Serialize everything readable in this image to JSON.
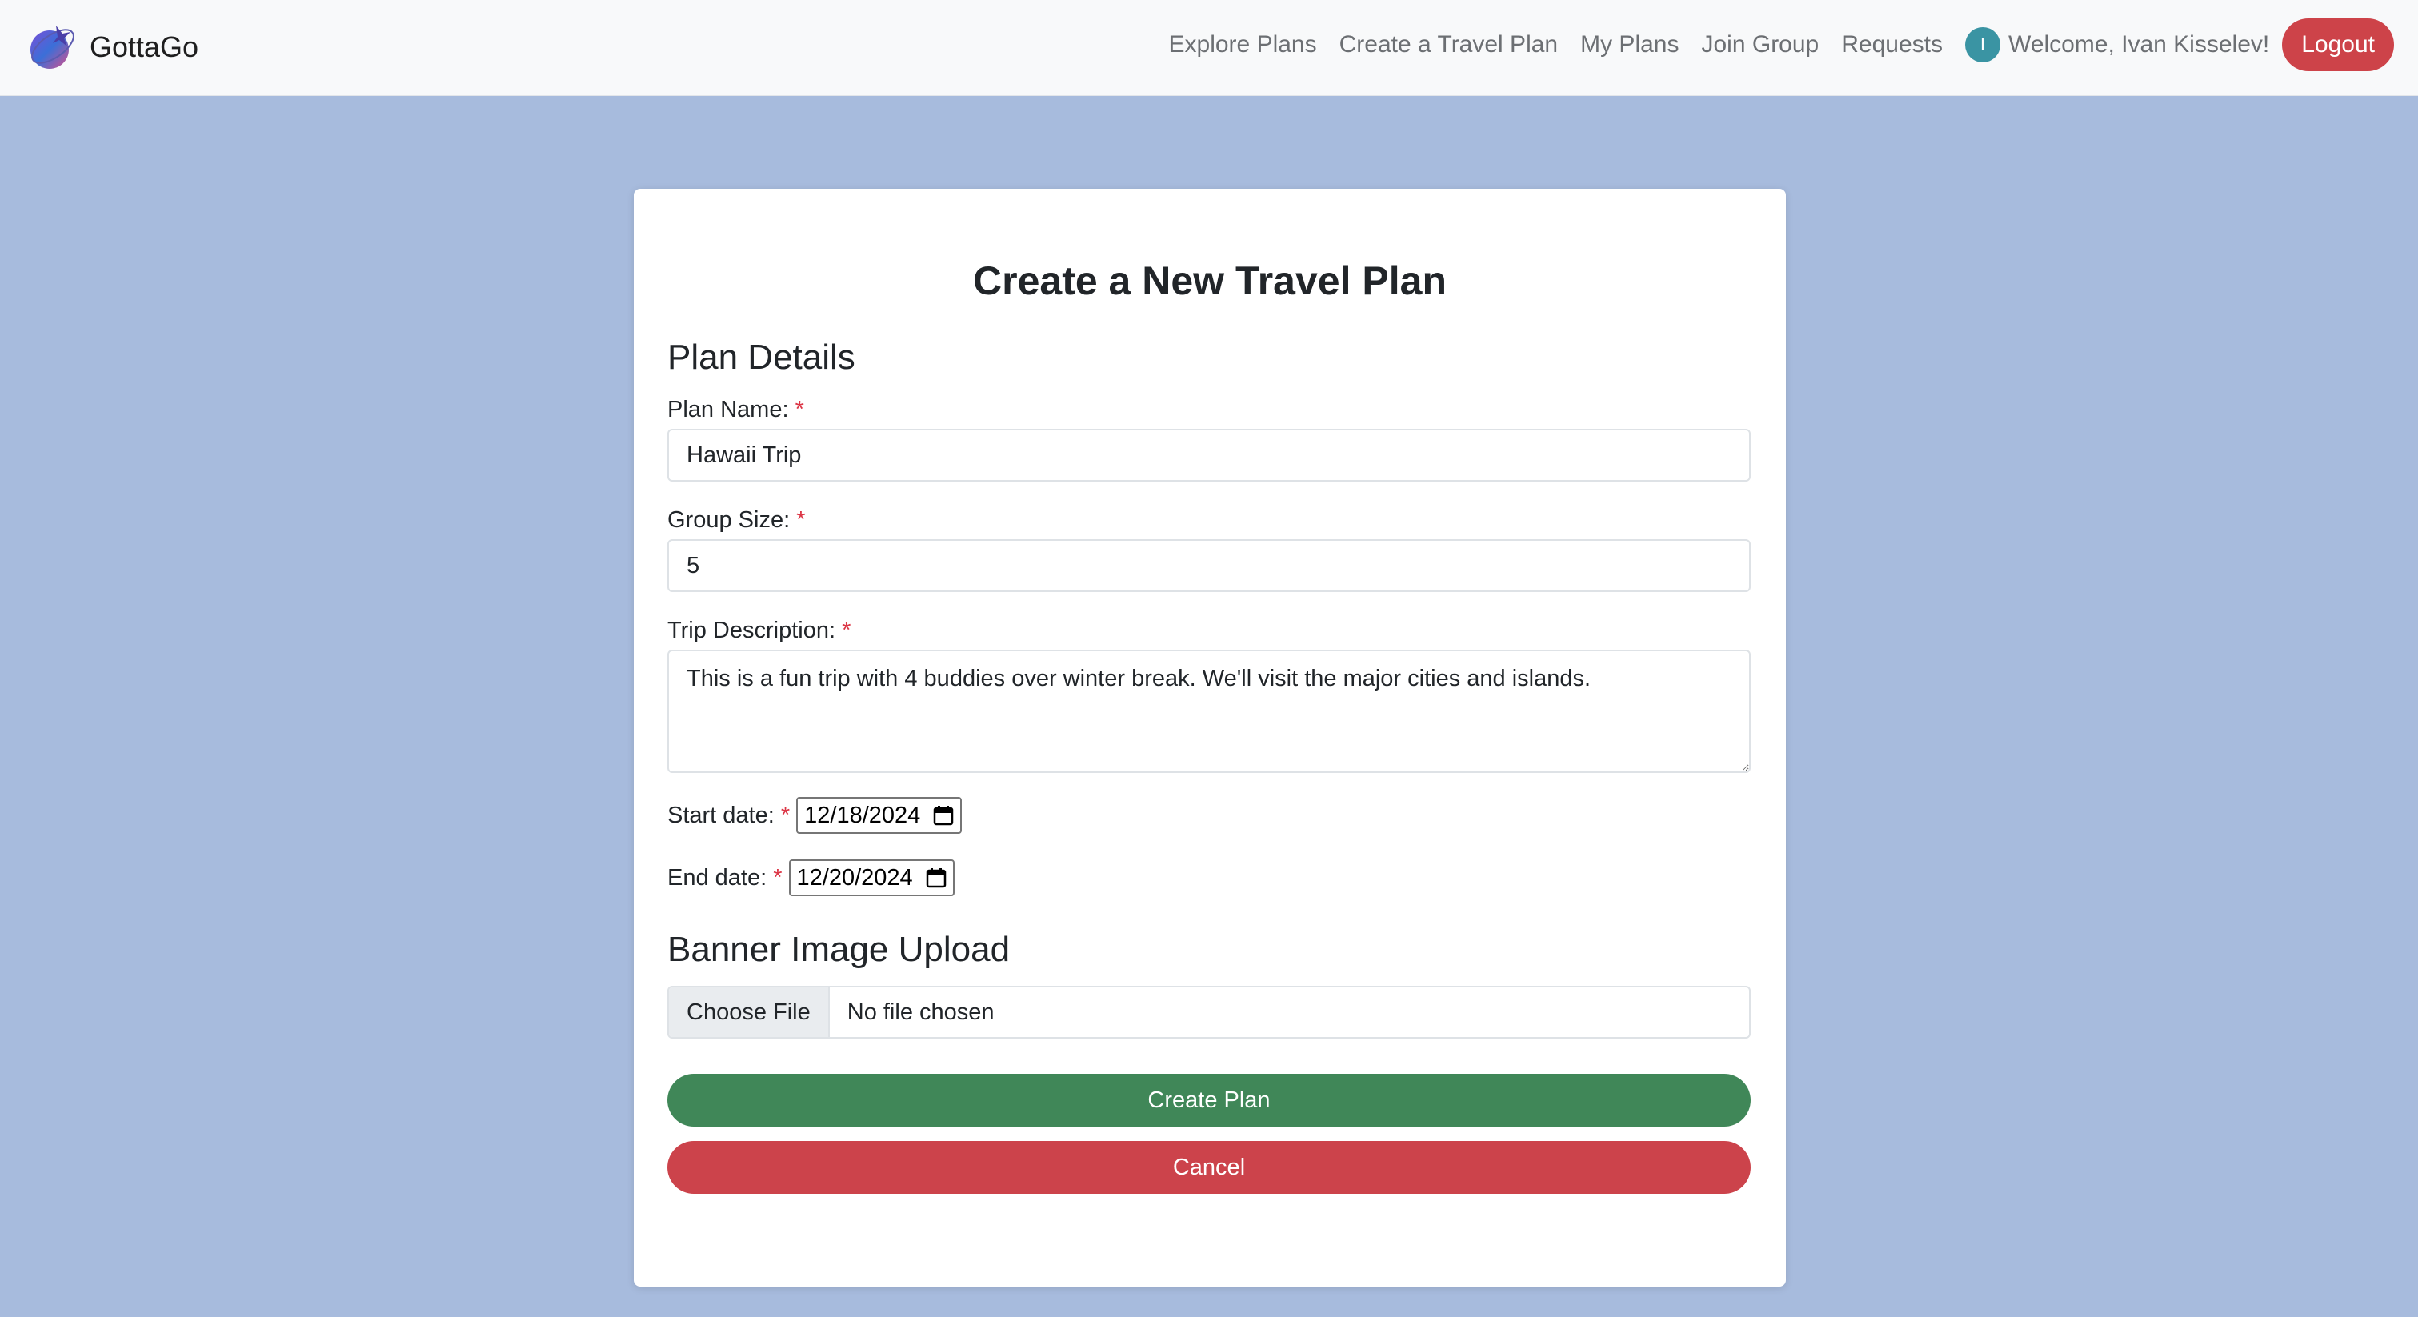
{
  "brand": {
    "name": "GottaGo",
    "logo_icon": "globe-plane-logo-icon"
  },
  "nav": {
    "links": [
      "Explore Plans",
      "Create a Travel Plan",
      "My Plans",
      "Join Group",
      "Requests"
    ],
    "avatar_initial": "I",
    "welcome": "Welcome, Ivan Kisselev!",
    "logout_label": "Logout"
  },
  "form": {
    "title": "Create a New Travel Plan",
    "section_details": "Plan Details",
    "plan_name": {
      "label": "Plan Name:",
      "required_mark": "*",
      "value": "Hawaii Trip"
    },
    "group_size": {
      "label": "Group Size:",
      "required_mark": "*",
      "value": "5"
    },
    "description": {
      "label": "Trip Description:",
      "required_mark": "*",
      "value": "This is a fun trip with 4 buddies over winter break. We'll visit the major cities and islands."
    },
    "start_date": {
      "label": "Start date:",
      "required_mark": "*",
      "value": "12/18/2024"
    },
    "end_date": {
      "label": "End date:",
      "required_mark": "*",
      "value": "12/20/2024"
    },
    "section_banner": "Banner Image Upload",
    "file": {
      "button_label": "Choose File",
      "status": "No file chosen"
    },
    "create_label": "Create Plan",
    "cancel_label": "Cancel"
  },
  "colors": {
    "page_background": "#a7bbdd",
    "navbar_background": "#f8f9fa",
    "create_button": "#408758",
    "cancel_button": "#cc434b",
    "logout_button": "#cd4349",
    "avatar": "#3a94a3",
    "required": "#dc3545"
  }
}
